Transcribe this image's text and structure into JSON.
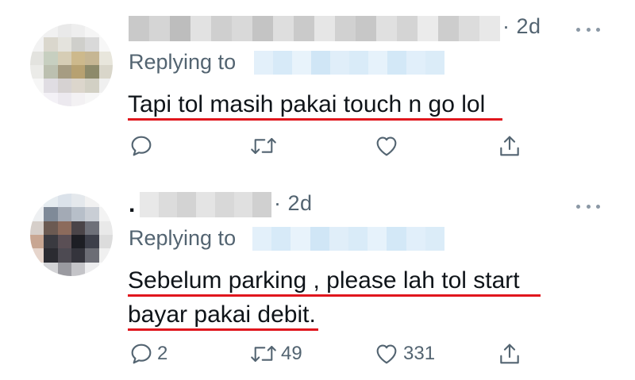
{
  "tweets": [
    {
      "time": "· 2d",
      "replying_label": "Replying to",
      "text_lines": [
        "Tapi tol masih pakai touch n go lol"
      ],
      "counts": {
        "reply": "",
        "retweet": "",
        "like": ""
      }
    },
    {
      "lead_char": ".",
      "time": "· 2d",
      "replying_label": "Replying to",
      "text_lines": [
        "Sebelum parking , please lah tol start",
        "bayar pakai debit."
      ],
      "counts": {
        "reply": "2",
        "retweet": "49",
        "like": "331"
      }
    }
  ],
  "icons": {
    "reply": "reply-icon",
    "retweet": "retweet-icon",
    "like": "heart-icon",
    "share": "share-icon",
    "more": "more-icon"
  },
  "colors": {
    "text": "#0f1419",
    "secondary": "#536471",
    "underline": "#e0161d",
    "blur_handle": "#d7eaf8",
    "blur_name": "#c8c8c8"
  }
}
